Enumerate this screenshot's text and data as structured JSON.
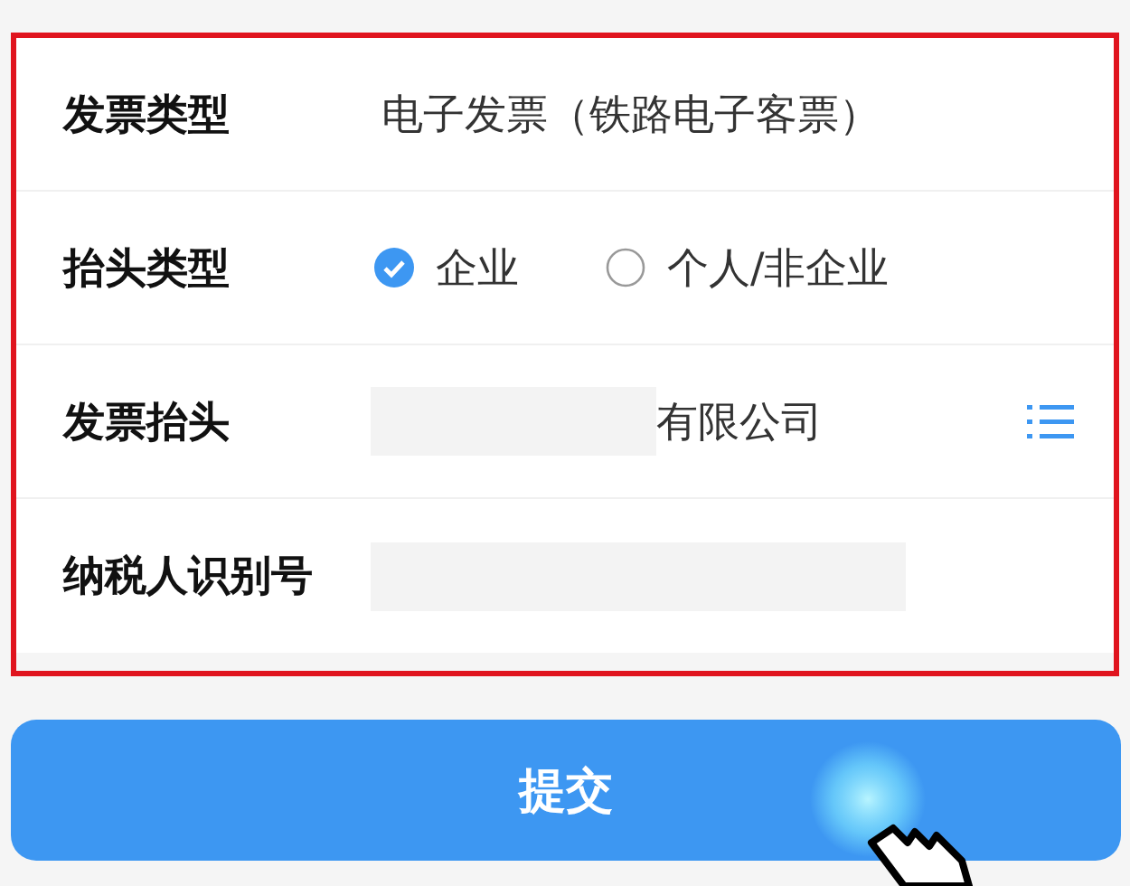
{
  "invoice_form": {
    "rows": [
      {
        "kind": "text",
        "label": "发票类型",
        "value": "电子发票（铁路电子客票）"
      },
      {
        "kind": "radio",
        "label": "抬头类型",
        "options": [
          {
            "label": "企业",
            "selected": true
          },
          {
            "label": "个人/非企业",
            "selected": false
          }
        ]
      },
      {
        "kind": "title",
        "label": "发票抬头",
        "value": "有限公司"
      },
      {
        "kind": "masked",
        "label": "纳税人识别号"
      }
    ]
  },
  "submit_button": {
    "label": "提交"
  }
}
